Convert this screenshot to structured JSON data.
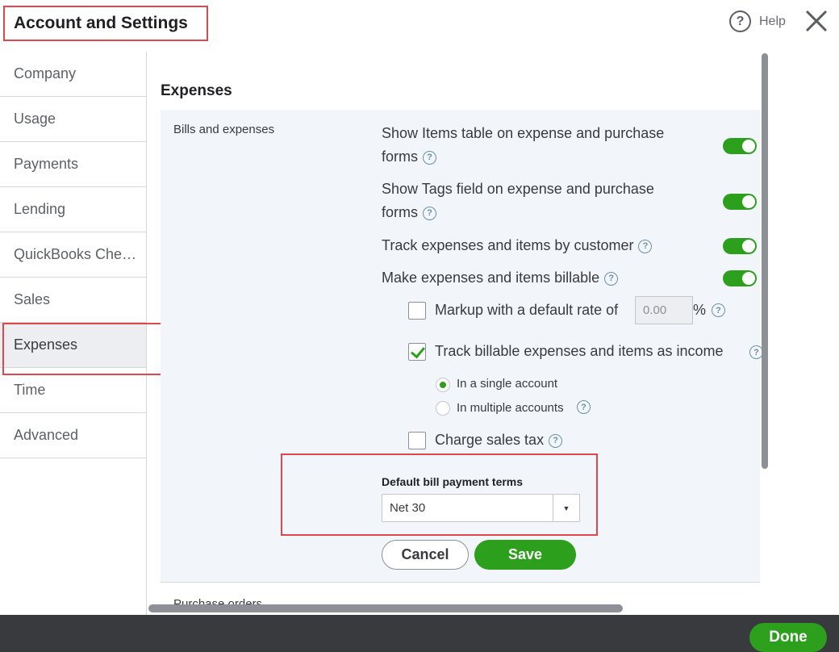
{
  "header": {
    "title": "Account and Settings",
    "help_label": "Help",
    "help_icon": "question-circle-icon",
    "close_icon": "close-icon"
  },
  "sidebar": {
    "items": [
      {
        "label": "Company"
      },
      {
        "label": "Usage"
      },
      {
        "label": "Payments"
      },
      {
        "label": "Lending"
      },
      {
        "label": "QuickBooks Che…"
      },
      {
        "label": "Sales"
      },
      {
        "label": "Expenses",
        "active": true
      },
      {
        "label": "Time"
      },
      {
        "label": "Advanced"
      }
    ]
  },
  "main": {
    "section_title": "Expenses",
    "panel_label": "Bills and expenses",
    "options": [
      {
        "label_line1": "Show Items table on expense and purchase",
        "label_line2": "forms",
        "enabled": true
      },
      {
        "label_line1": "Show Tags field on expense and purchase",
        "label_line2": "forms",
        "enabled": true
      },
      {
        "label": "Track expenses and items by customer",
        "enabled": true
      },
      {
        "label": "Make expenses and items billable",
        "enabled": true
      }
    ],
    "markup": {
      "label": "Markup with a default rate of",
      "value": "0.00",
      "unit": "%",
      "checked": false
    },
    "track_income": {
      "label": "Track billable expenses and items as income",
      "checked": true
    },
    "radios": [
      {
        "label": "In a single account",
        "selected": true
      },
      {
        "label": "In multiple accounts",
        "selected": false
      }
    ],
    "charge_tax": {
      "label": "Charge sales tax",
      "checked": false
    },
    "bill_terms": {
      "label": "Default bill payment terms",
      "value": "Net 30"
    },
    "cancel_label": "Cancel",
    "save_label": "Save",
    "next_section": "Purchase orders"
  },
  "footer": {
    "done_label": "Done"
  },
  "colors": {
    "accent": "#2ca01c",
    "highlight": "#e0474c",
    "footer": "#393a3d"
  }
}
